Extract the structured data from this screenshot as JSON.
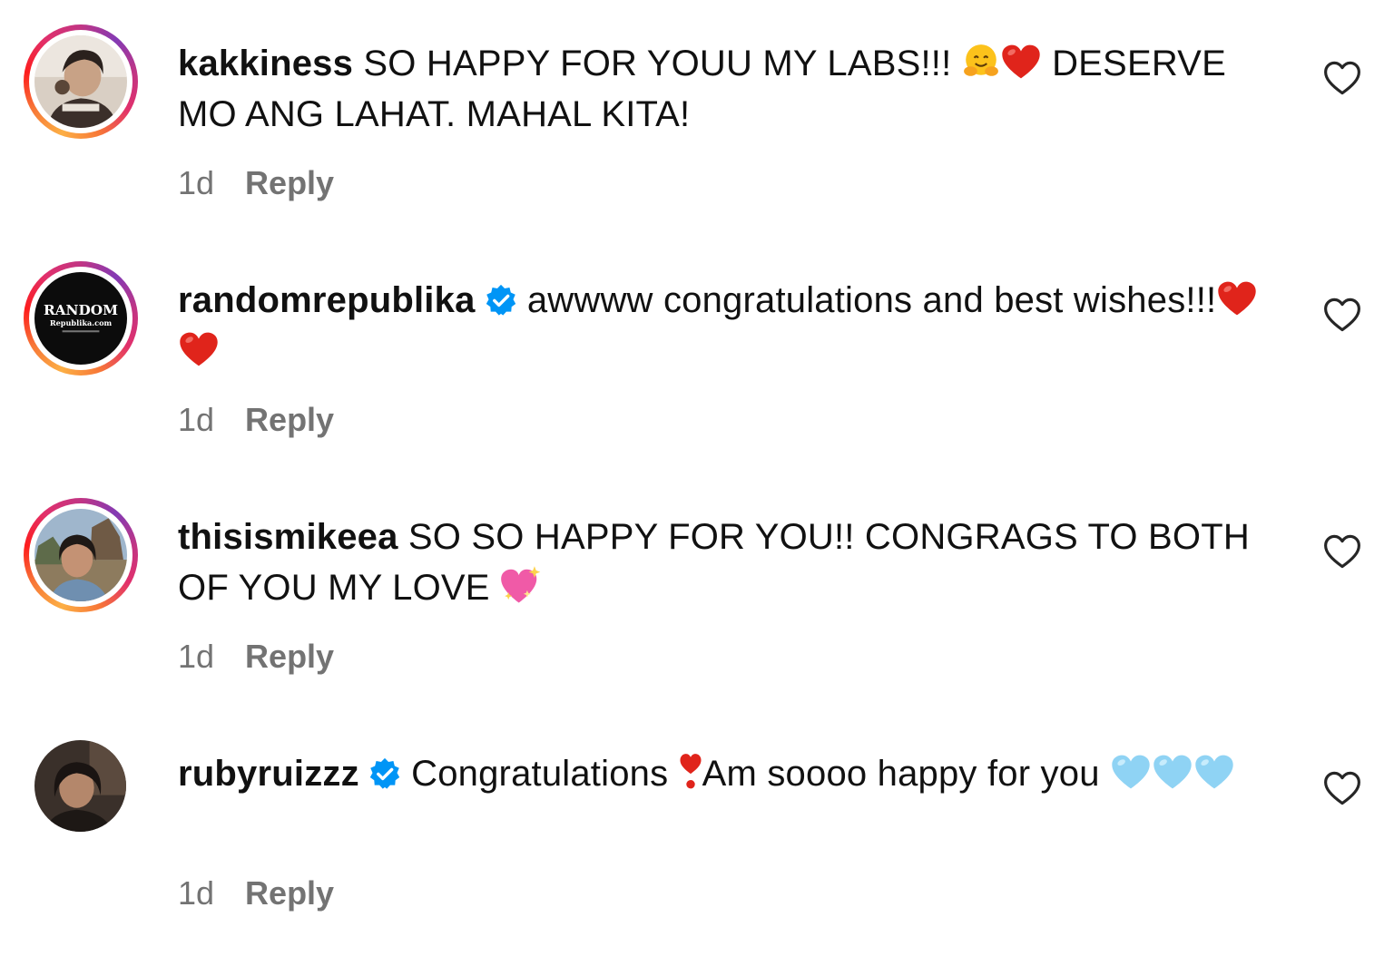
{
  "comments": [
    {
      "username": "kakkiness",
      "verified": false,
      "avatar_icon": "avatar-photo-kakkiness",
      "text_a": "SO HAPPY FOR YOUU MY LABS!!!",
      "emojis_a": [
        "hugging-face-emoji",
        "red-heart-emoji"
      ],
      "text_b": "DESERVE MO ANG LAHAT. MAHAL KITA!",
      "time": "1d",
      "reply": "Reply"
    },
    {
      "username": "randomrepublika",
      "verified": true,
      "avatar_icon": "avatar-logo-randomrepublika",
      "avatar_text_1": "RANDOM",
      "avatar_text_2": "Republika.com",
      "text_a": "awwww congratulations and best wishes!!!",
      "emojis_a": [
        "red-heart-emoji",
        "red-heart-emoji"
      ],
      "text_b": "",
      "time": "1d",
      "reply": "Reply"
    },
    {
      "username": "thisismikeea",
      "verified": false,
      "avatar_icon": "avatar-photo-thisismikeea",
      "text_a": "SO SO HAPPY FOR YOU!! CONGRAGS TO BOTH OF YOU MY LOVE",
      "emojis_a": [
        "sparkling-heart-emoji"
      ],
      "text_b": "",
      "time": "1d",
      "reply": "Reply"
    },
    {
      "username": "rubyruizzz",
      "verified": true,
      "avatar_icon": "avatar-photo-rubyruizzz",
      "text_a": "Congratulations",
      "emojis_a": [
        "heart-exclamation-emoji"
      ],
      "text_b": "Am soooo happy for you",
      "emojis_b": [
        "light-blue-heart-emoji",
        "light-blue-heart-emoji",
        "light-blue-heart-emoji"
      ],
      "time": "1d",
      "reply": "Reply"
    }
  ],
  "colors": {
    "verified_badge": "#0095f6",
    "meta_text": "#737373",
    "story_ring_start": "#fcaf45",
    "story_ring_end": "#c13584"
  }
}
